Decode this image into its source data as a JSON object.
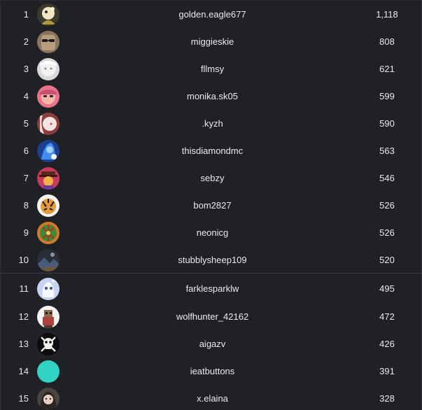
{
  "leaderboard": {
    "entries": [
      {
        "rank": "1",
        "name": "golden.eagle677",
        "score": "1,118",
        "avatar": "avatar-eagle-icon"
      },
      {
        "rank": "2",
        "name": "miggieskie",
        "score": "808",
        "avatar": "avatar-sunglasses-icon"
      },
      {
        "rank": "3",
        "name": "fllmsy",
        "score": "621",
        "avatar": "avatar-white-hair-icon"
      },
      {
        "rank": "4",
        "name": "monika.sk05",
        "score": "599",
        "avatar": "avatar-pink-face-icon"
      },
      {
        "rank": "5",
        "name": ".kyzh",
        "score": "590",
        "avatar": "avatar-pale-figure-icon"
      },
      {
        "rank": "6",
        "name": "thisdiamondmc",
        "score": "563",
        "avatar": "avatar-blue-character-icon"
      },
      {
        "rank": "7",
        "name": "sebzy",
        "score": "546",
        "avatar": "avatar-hat-character-icon"
      },
      {
        "rank": "8",
        "name": "bom2827",
        "score": "526",
        "avatar": "avatar-tiger-icon"
      },
      {
        "rank": "9",
        "name": "neonicg",
        "score": "526",
        "avatar": "avatar-green-pattern-icon"
      },
      {
        "rank": "10",
        "name": "stubblysheep109",
        "score": "520",
        "avatar": "avatar-dark-landscape-icon"
      },
      {
        "rank": "11",
        "name": "farklesparklw",
        "score": "495",
        "avatar": "avatar-white-creature-icon"
      },
      {
        "rank": "12",
        "name": "wolfhunter_42162",
        "score": "472",
        "avatar": "avatar-pixel-character-icon"
      },
      {
        "rank": "13",
        "name": "aigazv",
        "score": "426",
        "avatar": "avatar-skull-crossbones-icon"
      },
      {
        "rank": "14",
        "name": "ieatbuttons",
        "score": "391",
        "avatar": "avatar-teal-circle-icon"
      },
      {
        "rank": "15",
        "name": "x.elaina",
        "score": "328",
        "avatar": "avatar-portrait-icon"
      }
    ]
  },
  "colors": {
    "background": "#1f2125",
    "text": "#e9eaec",
    "divider": "#3a3d44",
    "teal_avatar": "#2fd2c3"
  }
}
